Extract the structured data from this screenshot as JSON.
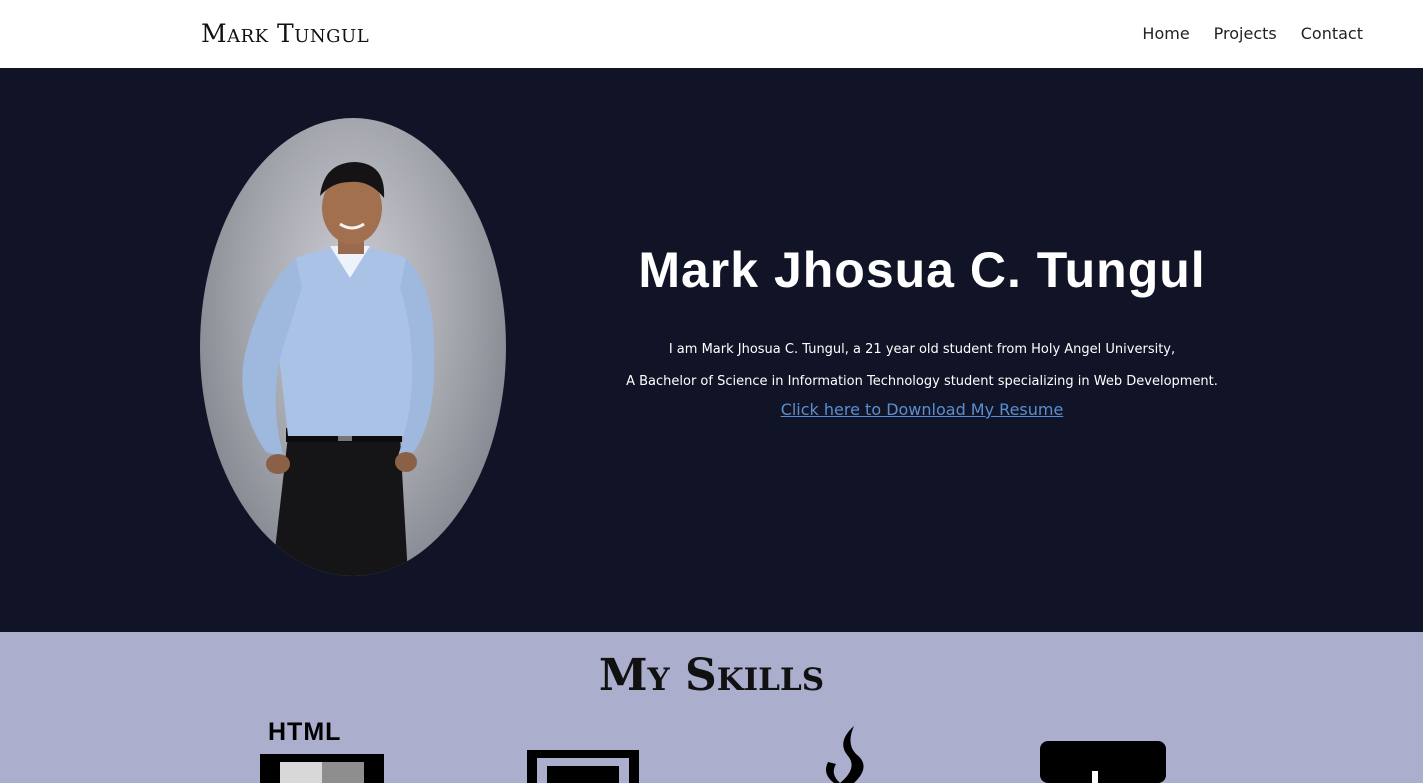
{
  "navbar": {
    "brand": "Mark Tungul",
    "links": [
      "Home",
      "Projects",
      "Contact"
    ]
  },
  "hero": {
    "name": "Mark Jhosua C. Tungul",
    "intro_line1": "I am Mark Jhosua C. Tungul, a 21 year old student from Holy Angel University,",
    "intro_line2": "A Bachelor of Science in Information Technology student specializing in Web Development.",
    "resume_link": "Click here to Download My Resume"
  },
  "skills": {
    "title": "My Skills",
    "items": [
      {
        "name": "html5-icon",
        "label": "HTML"
      },
      {
        "name": "css3-icon"
      },
      {
        "name": "java-icon"
      },
      {
        "name": "code-editor-icon"
      }
    ]
  },
  "colors": {
    "hero_background": "#101426",
    "skills_background": "#abaecc",
    "link": "#5a8ed0"
  }
}
